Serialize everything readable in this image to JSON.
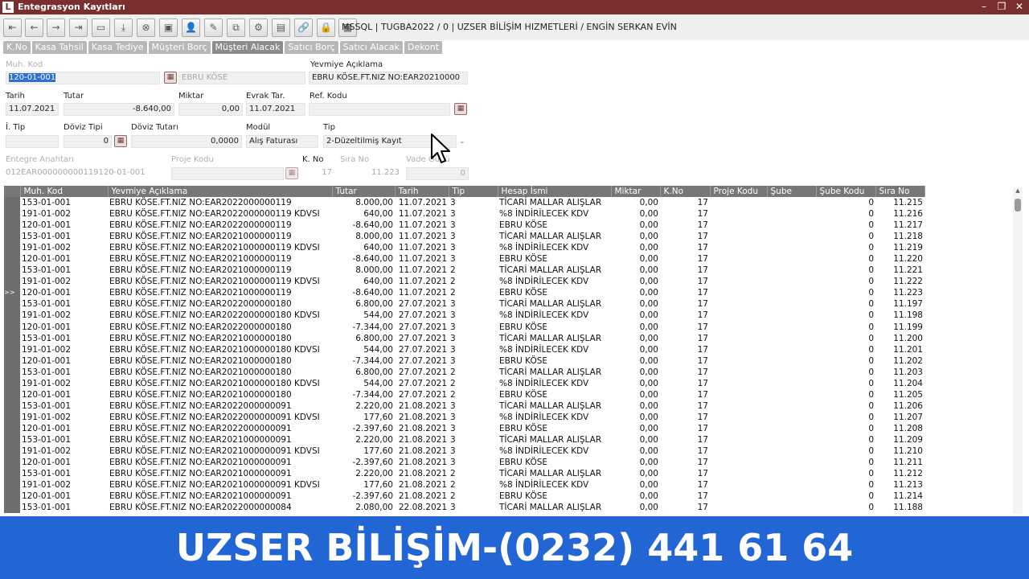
{
  "window": {
    "logo_letter": "L",
    "title": "Entegrasyon Kayıtları",
    "controls": [
      "–",
      "❐",
      "✕"
    ]
  },
  "toolbar": {
    "icons": [
      "first-record-icon",
      "prev-record-icon",
      "next-record-icon",
      "last-record-icon",
      "folder-icon",
      "download-icon",
      "cancel-icon",
      "folder-add-icon",
      "user-icon",
      "edit-icon",
      "copy-icon",
      "settings-icon",
      "note-icon",
      "link-icon",
      "lock-icon",
      "report-icon"
    ],
    "glyphs": [
      "⇤",
      "←",
      "→",
      "⇥",
      "▭",
      "⤓",
      "⊗",
      "▣",
      "👤",
      "✎",
      "⧉",
      "⚙",
      "▤",
      "🔗",
      "🔒",
      "▦"
    ],
    "connection": "MSSQL | TUGBA2022 / 0 | UZSER BİLİŞİM HIZMETLERİ / ENGİN SERKAN EVİN"
  },
  "tabs": [
    "K.No",
    "Kasa Tahsil",
    "Kasa Tediye",
    "Müşteri Borç",
    "Müşteri Alacak",
    "Satıcı Borç",
    "Satıcı Alacak",
    "Dekont"
  ],
  "active_tab": "Müşteri Alacak",
  "form": {
    "muh_kod_label": "Muh. Kod",
    "muh_kod": "120-01-001",
    "muh_kod_name": "EBRU KÖSE",
    "yevmiye_label": "Yevmiye Açıklama",
    "yevmiye": "EBRU KÖSE.FT.NIZ NO:EAR20210000",
    "tarih_label": "Tarih",
    "tarih": "11.07.2021",
    "tutar_label": "Tutar",
    "tutar": "-8.640,00",
    "miktar_label": "Miktar",
    "miktar": "0,00",
    "evrak_tar_label": "Evrak Tar.",
    "evrak_tar": "11.07.2021",
    "ref_kodu_label": "Ref. Kodu",
    "ref_kodu": "",
    "i_tip_label": "İ. Tip",
    "i_tip": "",
    "doviz_tipi_label": "Döviz Tipi",
    "doviz_tipi": "0",
    "doviz_tutari_label": "Döviz Tutarı",
    "doviz_tutari": "0,0000",
    "modul_label": "Modül",
    "modul": "Alış Faturası",
    "tip_label": "Tip",
    "tip": "2-Düzeltilmiş Kayıt",
    "entegre_label": "Entegre Anahtarı",
    "entegre": "012EAR000000000119120-01-001",
    "proje_label": "Proje Kodu",
    "proje": "",
    "kno_label": "K. No",
    "kno": "17",
    "sira_label": "Sıra No",
    "sira": "11.223",
    "vade_label": "Vade Günü",
    "vade": "0"
  },
  "grid": {
    "columns": [
      "Muh. Kod",
      "Yevmiye Açıklama",
      "Tutar",
      "Tarih",
      "Tip",
      "Hesap İsmi",
      "Miktar",
      "K.No",
      "Proje Kodu",
      "Şube",
      "Şube Kodu",
      "Sıra No"
    ],
    "rows": [
      [
        "",
        "153-01-001",
        "EBRU KÖSE.FT.NIZ NO:EAR2022000000119",
        "8.000,00",
        "11.07.2021",
        "3",
        "TİCARİ MALLAR ALIŞLAR",
        "0,00",
        "17",
        "",
        "",
        "0",
        "11.215"
      ],
      [
        "",
        "191-01-002",
        "EBRU KÖSE.FT.NIZ NO:EAR2022000000119 KDVSI",
        "640,00",
        "11.07.2021",
        "3",
        "%8 İNDİRİLECEK KDV",
        "0,00",
        "17",
        "",
        "",
        "0",
        "11.216"
      ],
      [
        "",
        "120-01-001",
        "EBRU KÖSE.FT.NIZ NO:EAR2022000000119",
        "-8.640,00",
        "11.07.2021",
        "3",
        "EBRU KÖSE",
        "0,00",
        "17",
        "",
        "",
        "0",
        "11.217"
      ],
      [
        "",
        "153-01-001",
        "EBRU KÖSE.FT.NIZ NO:EAR2021000000119",
        "8.000,00",
        "11.07.2021",
        "3",
        "TİCARİ MALLAR ALIŞLAR",
        "0,00",
        "17",
        "",
        "",
        "0",
        "11.218"
      ],
      [
        "",
        "191-01-002",
        "EBRU KÖSE.FT.NIZ NO:EAR2021000000119 KDVSI",
        "640,00",
        "11.07.2021",
        "3",
        "%8 İNDİRİLECEK KDV",
        "0,00",
        "17",
        "",
        "",
        "0",
        "11.219"
      ],
      [
        "",
        "120-01-001",
        "EBRU KÖSE.FT.NIZ NO:EAR2021000000119",
        "-8.640,00",
        "11.07.2021",
        "3",
        "EBRU KÖSE",
        "0,00",
        "17",
        "",
        "",
        "0",
        "11.220"
      ],
      [
        "",
        "153-01-001",
        "EBRU KÖSE.FT.NIZ NO:EAR2021000000119",
        "8.000,00",
        "11.07.2021",
        "2",
        "TİCARİ MALLAR ALIŞLAR",
        "0,00",
        "17",
        "",
        "",
        "0",
        "11.221"
      ],
      [
        "",
        "191-01-002",
        "EBRU KÖSE.FT.NIZ NO:EAR2021000000119 KDVSI",
        "640,00",
        "11.07.2021",
        "2",
        "%8 İNDİRİLECEK KDV",
        "0,00",
        "17",
        "",
        "",
        "0",
        "11.222"
      ],
      [
        ">>",
        "120-01-001",
        "EBRU KÖSE.FT.NIZ NO:EAR2021000000119",
        "-8.640,00",
        "11.07.2021",
        "2",
        "EBRU KÖSE",
        "0,00",
        "17",
        "",
        "",
        "0",
        "11.223"
      ],
      [
        "",
        "153-01-001",
        "EBRU KÖSE.FT.NIZ NO:EAR2022000000180",
        "6.800,00",
        "27.07.2021",
        "3",
        "TİCARİ MALLAR ALIŞLAR",
        "0,00",
        "17",
        "",
        "",
        "0",
        "11.197"
      ],
      [
        "",
        "191-01-002",
        "EBRU KÖSE.FT.NIZ NO:EAR2022000000180 KDVSI",
        "544,00",
        "27.07.2021",
        "3",
        "%8 İNDİRİLECEK KDV",
        "0,00",
        "17",
        "",
        "",
        "0",
        "11.198"
      ],
      [
        "",
        "120-01-001",
        "EBRU KÖSE.FT.NIZ NO:EAR2022000000180",
        "-7.344,00",
        "27.07.2021",
        "3",
        "EBRU KÖSE",
        "0,00",
        "17",
        "",
        "",
        "0",
        "11.199"
      ],
      [
        "",
        "153-01-001",
        "EBRU KÖSE.FT.NIZ NO:EAR2021000000180",
        "6.800,00",
        "27.07.2021",
        "3",
        "TİCARİ MALLAR ALIŞLAR",
        "0,00",
        "17",
        "",
        "",
        "0",
        "11.200"
      ],
      [
        "",
        "191-01-002",
        "EBRU KÖSE.FT.NIZ NO:EAR2021000000180 KDVSI",
        "544,00",
        "27.07.2021",
        "3",
        "%8 İNDİRİLECEK KDV",
        "0,00",
        "17",
        "",
        "",
        "0",
        "11.201"
      ],
      [
        "",
        "120-01-001",
        "EBRU KÖSE.FT.NIZ NO:EAR2021000000180",
        "-7.344,00",
        "27.07.2021",
        "3",
        "EBRU KÖSE",
        "0,00",
        "17",
        "",
        "",
        "0",
        "11.202"
      ],
      [
        "",
        "153-01-001",
        "EBRU KÖSE.FT.NIZ NO:EAR2021000000180",
        "6.800,00",
        "27.07.2021",
        "2",
        "TİCARİ MALLAR ALIŞLAR",
        "0,00",
        "17",
        "",
        "",
        "0",
        "11.203"
      ],
      [
        "",
        "191-01-002",
        "EBRU KÖSE.FT.NIZ NO:EAR2021000000180 KDVSI",
        "544,00",
        "27.07.2021",
        "2",
        "%8 İNDİRİLECEK KDV",
        "0,00",
        "17",
        "",
        "",
        "0",
        "11.204"
      ],
      [
        "",
        "120-01-001",
        "EBRU KÖSE.FT.NIZ NO:EAR2021000000180",
        "-7.344,00",
        "27.07.2021",
        "2",
        "EBRU KÖSE",
        "0,00",
        "17",
        "",
        "",
        "0",
        "11.205"
      ],
      [
        "",
        "153-01-001",
        "EBRU KÖSE.FT.NIZ NO:EAR2022000000091",
        "2.220,00",
        "21.08.2021",
        "3",
        "TİCARİ MALLAR ALIŞLAR",
        "0,00",
        "17",
        "",
        "",
        "0",
        "11.206"
      ],
      [
        "",
        "191-01-002",
        "EBRU KÖSE.FT.NIZ NO:EAR2022000000091 KDVSI",
        "177,60",
        "21.08.2021",
        "3",
        "%8 İNDİRİLECEK KDV",
        "0,00",
        "17",
        "",
        "",
        "0",
        "11.207"
      ],
      [
        "",
        "120-01-001",
        "EBRU KÖSE.FT.NIZ NO:EAR2022000000091",
        "-2.397,60",
        "21.08.2021",
        "3",
        "EBRU KÖSE",
        "0,00",
        "17",
        "",
        "",
        "0",
        "11.208"
      ],
      [
        "",
        "153-01-001",
        "EBRU KÖSE.FT.NIZ NO:EAR2021000000091",
        "2.220,00",
        "21.08.2021",
        "3",
        "TİCARİ MALLAR ALIŞLAR",
        "0,00",
        "17",
        "",
        "",
        "0",
        "11.209"
      ],
      [
        "",
        "191-01-002",
        "EBRU KÖSE.FT.NIZ NO:EAR2021000000091 KDVSI",
        "177,60",
        "21.08.2021",
        "3",
        "%8 İNDİRİLECEK KDV",
        "0,00",
        "17",
        "",
        "",
        "0",
        "11.210"
      ],
      [
        "",
        "120-01-001",
        "EBRU KÖSE.FT.NIZ NO:EAR2021000000091",
        "-2.397,60",
        "21.08.2021",
        "3",
        "EBRU KÖSE",
        "0,00",
        "17",
        "",
        "",
        "0",
        "11.211"
      ],
      [
        "",
        "153-01-001",
        "EBRU KÖSE.FT.NIZ NO:EAR2021000000091",
        "2.220,00",
        "21.08.2021",
        "2",
        "TİCARİ MALLAR ALIŞLAR",
        "0,00",
        "17",
        "",
        "",
        "0",
        "11.212"
      ],
      [
        "",
        "191-01-002",
        "EBRU KÖSE.FT.NIZ NO:EAR2021000000091 KDVSI",
        "177,60",
        "21.08.2021",
        "2",
        "%8 İNDİRİLECEK KDV",
        "0,00",
        "17",
        "",
        "",
        "0",
        "11.213"
      ],
      [
        "",
        "120-01-001",
        "EBRU KÖSE.FT.NIZ NO:EAR2021000000091",
        "-2.397,60",
        "21.08.2021",
        "2",
        "EBRU KÖSE",
        "0,00",
        "17",
        "",
        "",
        "0",
        "11.214"
      ],
      [
        "",
        "153-01-001",
        "EBRU KÖSE.FT.NIZ NO:EAR2022000000084",
        "2.080,00",
        "22.08.2021",
        "3",
        "TİCARİ MALLAR ALIŞLAR",
        "0,00",
        "17",
        "",
        "",
        "0",
        "11.188"
      ]
    ]
  },
  "banner": "UZSER BİLİŞİM-(0232) 441 61 64"
}
